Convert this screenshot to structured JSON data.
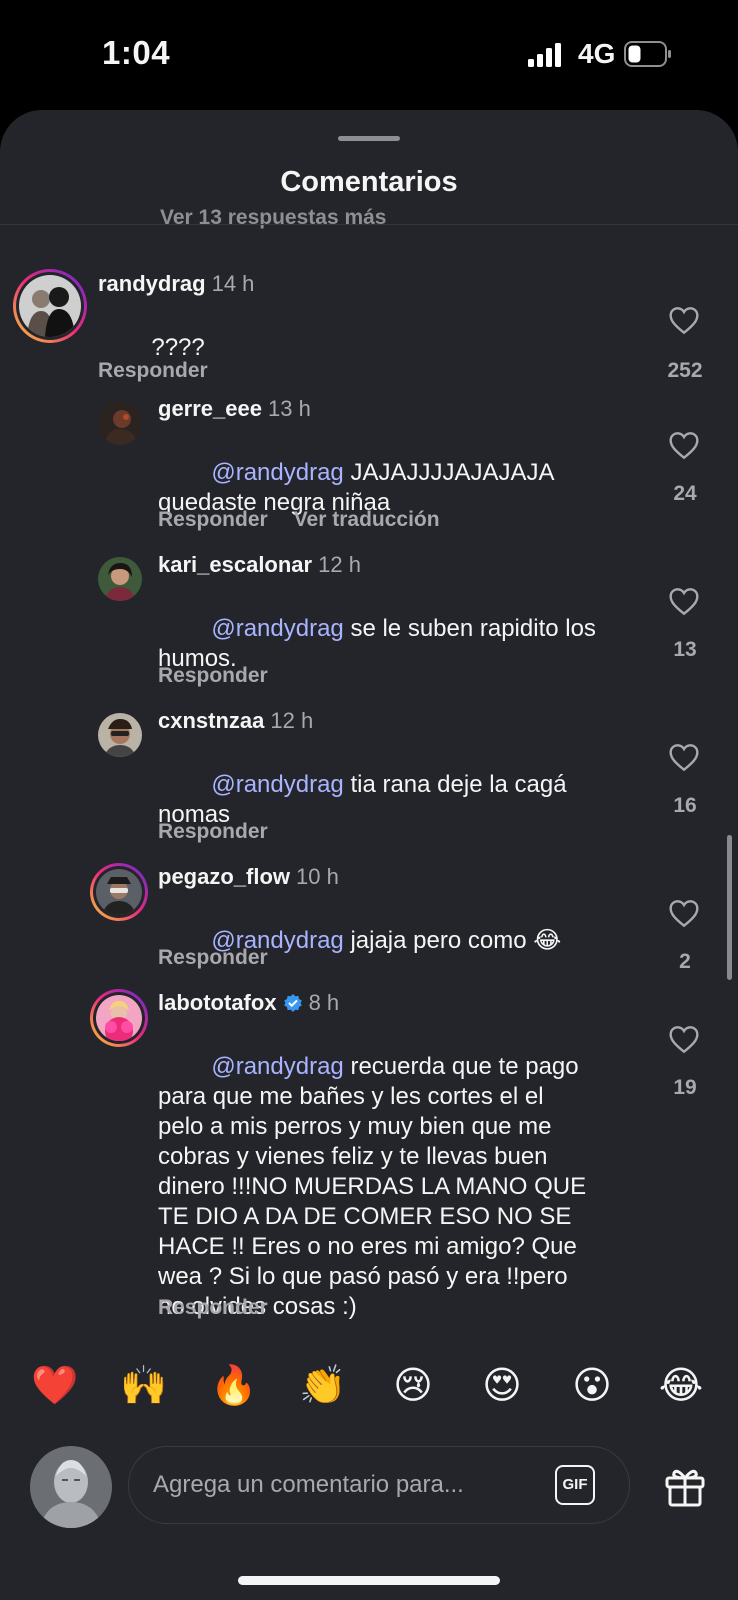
{
  "status_bar": {
    "time": "1:04",
    "network": "4G"
  },
  "sheet": {
    "title": "Comentarios",
    "cutoff_text": "Ver 13 respuestas más"
  },
  "comments": [
    {
      "username": "randydrag",
      "time": "14 h",
      "text": "????",
      "mention": "",
      "actions": [
        "Responder"
      ],
      "likes": "252"
    },
    {
      "username": "gerre_eee",
      "time": "13 h",
      "mention": "@randydrag",
      "text": " JAJAJJJJAJAJAJA\nquedaste negra niñaa",
      "actions": [
        "Responder",
        "Ver traducción"
      ],
      "likes": "24"
    },
    {
      "username": "kari_escalonar",
      "time": "12 h",
      "mention": "@randydrag",
      "text": " se le suben rapidito los\nhumos.",
      "actions": [
        "Responder"
      ],
      "likes": "13"
    },
    {
      "username": "cxnstnzaa",
      "time": "12 h",
      "mention": "@randydrag",
      "text": " tia rana deje la cagá\nnomas",
      "actions": [
        "Responder"
      ],
      "likes": "16"
    },
    {
      "username": "pegazo_flow",
      "time": "10 h",
      "mention": "@randydrag",
      "text": " jajaja pero como 😂",
      "actions": [
        "Responder"
      ],
      "likes": "2"
    },
    {
      "username": "labototafox",
      "time": "8 h",
      "verified": true,
      "mention": "@randydrag",
      "text": " recuerda que te pago\npara que me bañes y les cortes el el\npelo a mis perros y muy bien que me\ncobras y vienes feliz y te llevas buen\ndinero !!!NO MUERDAS LA MANO QUE\nTE DIO A DA DE COMER ESO NO SE\nHACE !! Eres o no eres mi amigo? Que\nwea ? Si lo que pasó pasó y era !!pero\nno olvides cosas :)",
      "actions": [
        "Responder"
      ],
      "likes": "19"
    }
  ],
  "reactions": [
    "❤️",
    "🙌",
    "🔥",
    "👏",
    "😢",
    "😍",
    "😮",
    "😂"
  ],
  "composer": {
    "placeholder": "Agrega un comentario para...",
    "gif_label": "GIF"
  },
  "icons": {
    "like": "heart-outline-icon",
    "gift": "gift-icon",
    "verified": "verified-badge-icon"
  },
  "colors": {
    "background": "#24252a",
    "mention": "#a8b4ff",
    "muted": "#a8a8ad",
    "verified": "#3897f0"
  }
}
